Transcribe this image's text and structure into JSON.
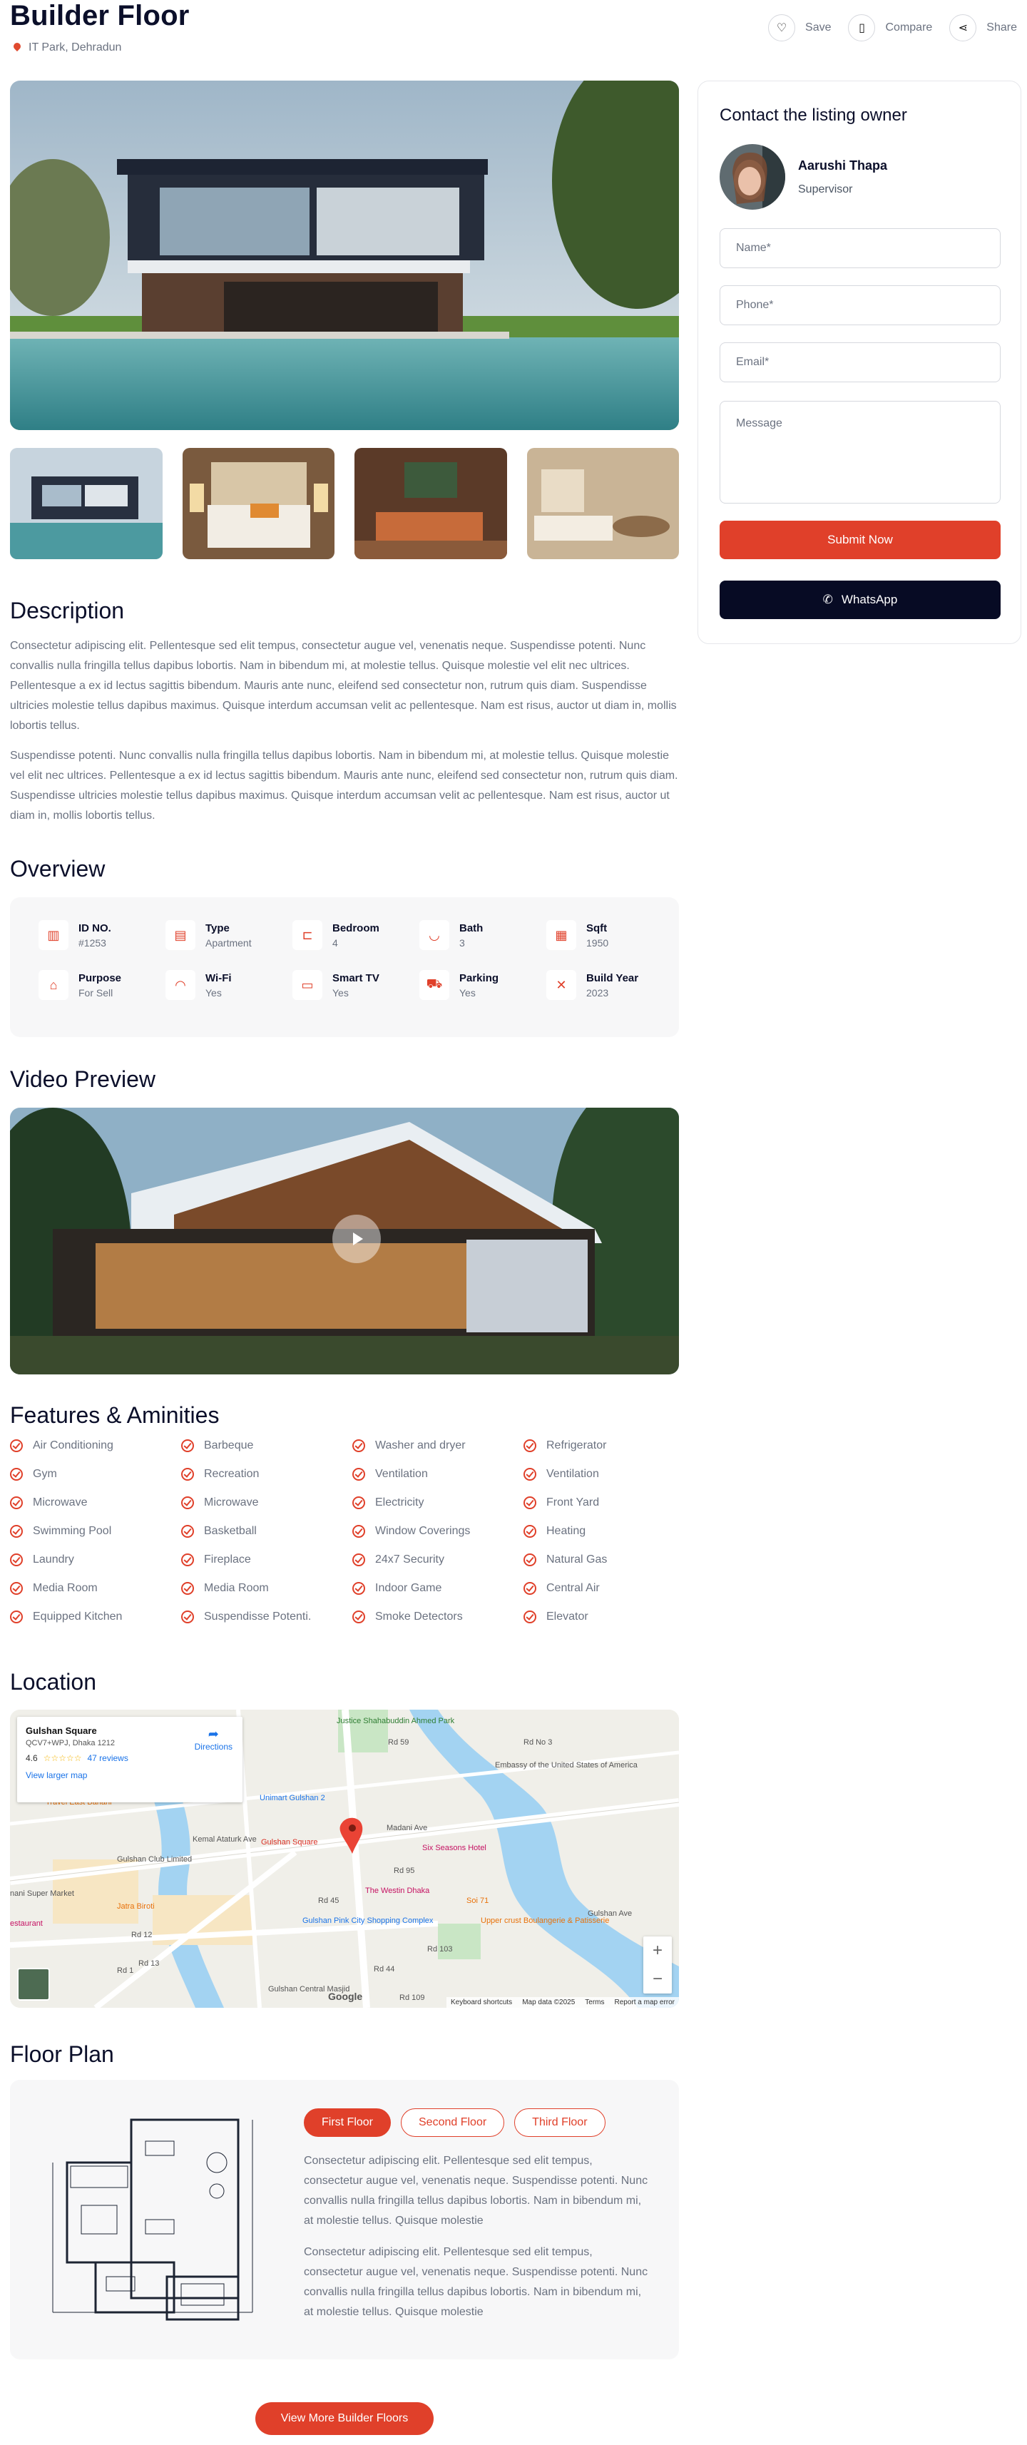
{
  "listing": {
    "title": "Builder Floor",
    "location": "IT Park, Dehradun"
  },
  "actions": [
    {
      "label": "Save",
      "icon": "heart-icon"
    },
    {
      "label": "Compare",
      "icon": "compare-icon"
    },
    {
      "label": "Share",
      "icon": "share-icon"
    }
  ],
  "contact": {
    "heading": "Contact the listing owner",
    "agent_name": "Aarushi Thapa",
    "agent_role": "Supervisor",
    "name_placeholder": "Name*",
    "phone_placeholder": "Phone*",
    "email_placeholder": "Email*",
    "message_placeholder": "Message",
    "submit_label": "Submit Now",
    "whatsapp_label": "WhatsApp"
  },
  "description": {
    "heading": "Description",
    "p1": "Consectetur adipiscing elit. Pellentesque sed elit tempus, consectetur augue vel, venenatis neque. Suspendisse potenti. Nunc convallis nulla fringilla tellus dapibus lobortis. Nam in bibendum mi, at molestie tellus. Quisque molestie vel elit nec ultrices. Pellentesque a ex id lectus sagittis bibendum. Mauris ante nunc, eleifend sed consectetur non, rutrum quis diam. Suspendisse ultricies molestie tellus dapibus maximus. Quisque interdum accumsan velit ac pellentesque. Nam est risus, auctor ut diam in, mollis lobortis tellus.",
    "p2": "Suspendisse potenti. Nunc convallis nulla fringilla tellus dapibus lobortis. Nam in bibendum mi, at molestie tellus. Quisque molestie vel elit nec ultrices. Pellentesque a ex id lectus sagittis bibendum. Mauris ante nunc, eleifend sed consectetur non, rutrum quis diam. Suspendisse ultricies molestie tellus dapibus maximus. Quisque interdum accumsan velit ac pellentesque. Nam est risus, auctor ut diam in, mollis lobortis tellus."
  },
  "overview": {
    "heading": "Overview",
    "items": [
      {
        "label": "ID NO.",
        "value": "#1253",
        "icon": "building-icon"
      },
      {
        "label": "Type",
        "value": "Apartment",
        "icon": "apartment-icon"
      },
      {
        "label": "Bedroom",
        "value": "4",
        "icon": "bed-icon"
      },
      {
        "label": "Bath",
        "value": "3",
        "icon": "bathtub-icon"
      },
      {
        "label": "Sqft",
        "value": "1950",
        "icon": "area-icon"
      },
      {
        "label": "Purpose",
        "value": "For Sell",
        "icon": "home-icon"
      },
      {
        "label": "Wi-Fi",
        "value": "Yes",
        "icon": "wifi-icon"
      },
      {
        "label": "Smart TV",
        "value": "Yes",
        "icon": "tv-icon"
      },
      {
        "label": "Parking",
        "value": "Yes",
        "icon": "car-icon"
      },
      {
        "label": "Build Year",
        "value": "2023",
        "icon": "tools-icon"
      }
    ]
  },
  "video": {
    "heading": "Video Preview"
  },
  "features": {
    "heading": "Features & Aminities",
    "items": [
      "Air Conditioning",
      "Barbeque",
      "Washer and dryer",
      "Refrigerator",
      "Gym",
      "Recreation",
      "Ventilation",
      "Ventilation",
      "Microwave",
      "Microwave",
      "Electricity",
      "Front Yard",
      "Swimming Pool",
      "Basketball",
      "Window Coverings",
      "Heating",
      "Laundry",
      "Fireplace",
      "24x7 Security",
      "Natural Gas",
      "Media Room",
      "Media Room",
      "Indoor Game",
      "Central Air",
      "Equipped Kitchen",
      "Suspendisse Potenti.",
      "Smoke Detectors",
      "Elevator"
    ]
  },
  "location": {
    "heading": "Location",
    "place": "Gulshan Square",
    "address": "QCV7+WPJ, Dhaka 1212",
    "rating": "4.6",
    "stars": "☆☆☆☆☆",
    "reviews": "47 reviews",
    "directions": "Directions",
    "larger_map": "View larger map",
    "footer": [
      "Keyboard shortcuts",
      "Map data ©2025",
      "Terms",
      "Report a map error"
    ],
    "google": "Google",
    "labels": [
      "Justice Shahabuddin Ahmed Park",
      "Unimart Gulshan 2",
      "Travel East Banani",
      "Gulshan Club Limited",
      "Gulshan Square",
      "Madani Ave",
      "Six Seasons Hotel",
      "Embassy of the United States of America",
      "Kemal Ataturk Ave",
      "The Westin Dhaka",
      "Jatra Biroti",
      "Gulshan Pink City Shopping Complex",
      "Upper crust Boulangerie & Patisserie",
      "Gulshan Central Masjid",
      "Soi 71",
      "Rd 103",
      "Rd 45",
      "Rd 44",
      "Rd 109",
      "Rd 95",
      "Rd 90",
      "Rd 1",
      "Rd 12",
      "Rd 13",
      "Gulshan Ave",
      "nani Super Market",
      "estaurant",
      "ead Grill",
      "Rd No 3",
      "Rd 59"
    ]
  },
  "floorplan": {
    "heading": "Floor Plan",
    "tabs": [
      "First Floor",
      "Second Floor",
      "Third Floor"
    ],
    "p1": "Consectetur adipiscing elit. Pellentesque sed elit tempus, consectetur augue vel, venenatis neque. Suspendisse potenti. Nunc convallis nulla fringilla tellus dapibus lobortis. Nam in bibendum mi, at molestie tellus. Quisque molestie",
    "p2": "Consectetur adipiscing elit. Pellentesque sed elit tempus, consectetur augue vel, venenatis neque. Suspendisse potenti. Nunc convallis nulla fringilla tellus dapibus lobortis. Nam in bibendum mi, at molestie tellus. Quisque molestie"
  },
  "more_label": "View More Builder Floors",
  "colors": {
    "accent": "#e0402a",
    "dark": "#070b24",
    "muted": "#6b7280"
  }
}
